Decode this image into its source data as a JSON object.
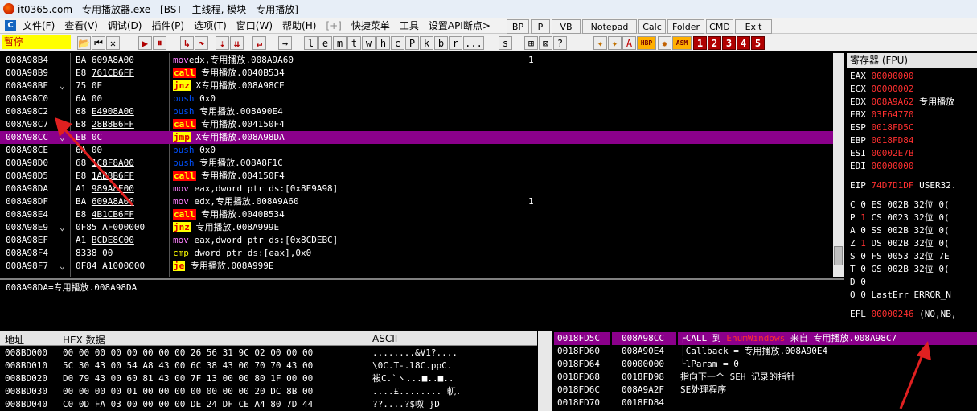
{
  "window": {
    "title": "it0365.com - 专用播放器.exe - [BST - 主线程, 模块 - 专用播放]"
  },
  "menu": {
    "items": [
      "文件(F)",
      "查看(V)",
      "调试(D)",
      "插件(P)",
      "选项(T)",
      "窗口(W)",
      "帮助(H)",
      "[+]",
      "快捷菜单",
      "工具",
      "设置API断点>"
    ],
    "extra_buttons": [
      "BP",
      "P",
      "VB",
      "Notepad",
      "Calc",
      "Folder",
      "CMD",
      "Exit"
    ]
  },
  "toolbar": {
    "status": "暂停",
    "letter_buttons": [
      "l",
      "e",
      "m",
      "t",
      "w",
      "h",
      "c",
      "P",
      "k",
      "b",
      "r",
      "...",
      "s"
    ],
    "number_buttons": [
      "1",
      "2",
      "3",
      "4",
      "5"
    ],
    "misc_labels": [
      "HBP",
      "ASM"
    ]
  },
  "disasm": {
    "rows": [
      {
        "addr": "008A98B4",
        "mark": " ",
        "bytes": "BA",
        "bytes_u": "609A8A00",
        "mn": "mov",
        "cls": "m-mov",
        "ops": "edx,专用播放.008A9A60",
        "cmt": "1"
      },
      {
        "addr": "008A98B9",
        "mark": " ",
        "bytes": "E8",
        "bytes_u": "761CB6FF",
        "mn": "call",
        "cls": "m-call",
        "ops": " 专用播放.0040B534",
        "cmt": ""
      },
      {
        "addr": "008A98BE",
        "mark": "⌄",
        "bytes": "75 0E",
        "bytes_u": "",
        "mn": "jnz",
        "cls": "m-jcc",
        "ops": " X专用播放.008A98CE",
        "cmt": ""
      },
      {
        "addr": "008A98C0",
        "mark": " ",
        "bytes": "6A 00",
        "bytes_u": "",
        "mn": "push",
        "cls": "m-push",
        "ops": " 0x0",
        "cmt": ""
      },
      {
        "addr": "008A98C2",
        "mark": " ",
        "bytes": "68",
        "bytes_u": "E4908A00",
        "mn": "push",
        "cls": "m-push",
        "ops": " 专用播放.008A90E4",
        "cmt": ""
      },
      {
        "addr": "008A98C7",
        "mark": " ",
        "bytes": "E8",
        "bytes_u": "28B8B6FF",
        "mn": "call",
        "cls": "m-call",
        "ops": " 专用播放.004150F4",
        "cmt": ""
      },
      {
        "addr": "008A98CC",
        "mark": "⌄",
        "bytes": "EB 0C",
        "bytes_u": "",
        "mn": "jmp",
        "cls": "m-jmp",
        "ops": " X专用播放.008A98DA",
        "cmt": "",
        "sel": true
      },
      {
        "addr": "008A98CE",
        "mark": " ",
        "bytes": "6A 00",
        "bytes_u": "",
        "mn": "push",
        "cls": "m-push",
        "ops": " 0x0",
        "cmt": ""
      },
      {
        "addr": "008A98D0",
        "mark": " ",
        "bytes": "68",
        "bytes_u": "1C8F8A00",
        "mn": "push",
        "cls": "m-push",
        "ops": " 专用播放.008A8F1C",
        "cmt": ""
      },
      {
        "addr": "008A98D5",
        "mark": " ",
        "bytes": "E8",
        "bytes_u": "1AB8B6FF",
        "mn": "call",
        "cls": "m-call",
        "ops": " 专用播放.004150F4",
        "cmt": ""
      },
      {
        "addr": "008A98DA",
        "mark": " ",
        "bytes": "A1",
        "bytes_u": "989A8E00",
        "mn": "mov",
        "cls": "m-mov",
        "ops": " eax,dword ptr ds:[0x8E9A98]",
        "cmt": ""
      },
      {
        "addr": "008A98DF",
        "mark": " ",
        "bytes": "BA",
        "bytes_u": "609A8A00",
        "mn": "mov",
        "cls": "m-mov",
        "ops": " edx,专用播放.008A9A60",
        "cmt": "1"
      },
      {
        "addr": "008A98E4",
        "mark": " ",
        "bytes": "E8",
        "bytes_u": "4B1CB6FF",
        "mn": "call",
        "cls": "m-call",
        "ops": " 专用播放.0040B534",
        "cmt": ""
      },
      {
        "addr": "008A98E9",
        "mark": "⌄",
        "bytes": "0F85 AF000000",
        "bytes_u": "",
        "mn": "jnz",
        "cls": "m-jcc",
        "ops": " 专用播放.008A999E",
        "cmt": ""
      },
      {
        "addr": "008A98EF",
        "mark": " ",
        "bytes": "A1",
        "bytes_u": "BCDE8C00",
        "mn": "mov",
        "cls": "m-mov",
        "ops": " eax,dword ptr ds:[0x8CDEBC]",
        "cmt": ""
      },
      {
        "addr": "008A98F4",
        "mark": " ",
        "bytes": "8338 00",
        "bytes_u": "",
        "mn": "cmp",
        "cls": "m-cmp",
        "ops": " dword ptr ds:[eax],0x0",
        "cmt": ""
      },
      {
        "addr": "008A98F7",
        "mark": "⌄",
        "bytes": "0F84 A1000000",
        "bytes_u": "",
        "mn": "je",
        "cls": "m-je",
        "ops": " 专用播放.008A999E",
        "cmt": ""
      }
    ]
  },
  "info_line": "008A98DA=专用播放.008A98DA",
  "registers": {
    "header": "寄存器 (FPU)",
    "lines": [
      {
        "name": "EAX",
        "value": "00000000",
        "extra": ""
      },
      {
        "name": "ECX",
        "value": "00000002",
        "extra": ""
      },
      {
        "name": "EDX",
        "value": "008A9A62",
        "extra": " 专用播放"
      },
      {
        "name": "EBX",
        "value": "03F64770",
        "extra": ""
      },
      {
        "name": "ESP",
        "value": "0018FD5C",
        "extra": ""
      },
      {
        "name": "EBP",
        "value": "0018FD84",
        "extra": ""
      },
      {
        "name": "ESI",
        "value": "00002E7B",
        "extra": ""
      },
      {
        "name": "EDI",
        "value": "00000000",
        "extra": ""
      },
      {
        "name": "EIP",
        "value": "74D7D1DF",
        "extra": " USER32."
      },
      {
        "name": "C 0",
        "value": "",
        "extra": "  ES 002B 32位 0("
      },
      {
        "name": "P",
        "value": "1",
        "extra": "  CS 0023 32位 0("
      },
      {
        "name": "A 0",
        "value": "",
        "extra": "  SS 002B 32位 0("
      },
      {
        "name": "Z",
        "value": "1",
        "extra": "  DS 002B 32位 0("
      },
      {
        "name": "S 0",
        "value": "",
        "extra": "  FS 0053 32位 7E"
      },
      {
        "name": "T 0",
        "value": "",
        "extra": "  GS 002B 32位 0("
      },
      {
        "name": "D 0",
        "value": "",
        "extra": ""
      },
      {
        "name": "O 0",
        "value": "",
        "extra": "  LastErr ERROR_N"
      },
      {
        "name": "EFL",
        "value": "00000246",
        "extra": " (NO,NB,"
      }
    ]
  },
  "dump": {
    "headers": {
      "addr": "地址",
      "hex": "HEX 数据",
      "ascii": "ASCII"
    },
    "rows": [
      {
        "addr": "008BD000",
        "hex": "00 00 00 00 00 00 00 00 26 56 31 9C 02 00 00 00",
        "ascii": "........&V1?...."
      },
      {
        "addr": "008BD010",
        "hex": "5C 30 43 00 54 A8 43 00 6C 38 43 00 70 70 43 00",
        "ascii": "\\0C.T-.l8C.ppC."
      },
      {
        "addr": "008BD020",
        "hex": "D0 79 43 00 60 81 43 00 7F 13 00 00 80 1F 00 00",
        "ascii": "祓C.`ヽ...■..■.."
      },
      {
        "addr": "008BD030",
        "hex": "00 00 00 00 01 00 00 00 00 00 00 00 20 DC 8B 00",
        "ascii": "....£........ 軏."
      },
      {
        "addr": "008BD040",
        "hex": "C0 0D FA 03 00 00 00 00 DE 24 DF CE A4 80 7D 44",
        "ascii": "??....?$呶  }D"
      }
    ]
  },
  "stack": {
    "rows": [
      {
        "addr": "0018FD5C",
        "val": "008A98CC",
        "cmt_pre": "┌CALL 到 ",
        "cmt_fn": "EnumWindows",
        "cmt_post": " 来自 专用播放.008A98C7",
        "sel": true
      },
      {
        "addr": "0018FD60",
        "val": "008A90E4",
        "cmt_pre": "│Callback = 专用播放.008A90E4",
        "cmt_fn": "",
        "cmt_post": "",
        "sel": false
      },
      {
        "addr": "0018FD64",
        "val": "00000000",
        "cmt_pre": "└lParam = 0",
        "cmt_fn": "",
        "cmt_post": "",
        "sel": false
      },
      {
        "addr": "0018FD68",
        "val": "0018FD98",
        "cmt_pre": "指向下一个 SEH 记录的指针",
        "cmt_fn": "",
        "cmt_post": "",
        "sel": false
      },
      {
        "addr": "0018FD6C",
        "val": "008A9A2F",
        "cmt_pre": "SE处理程序",
        "cmt_fn": "",
        "cmt_post": "",
        "sel": false
      },
      {
        "addr": "0018FD70",
        "val": "0018FD84",
        "cmt_pre": "",
        "cmt_fn": "",
        "cmt_post": "",
        "sel": false
      }
    ]
  },
  "colors": {
    "selection": "#8b008b",
    "register_value": "#ff3030",
    "arrow": "#e02020"
  }
}
